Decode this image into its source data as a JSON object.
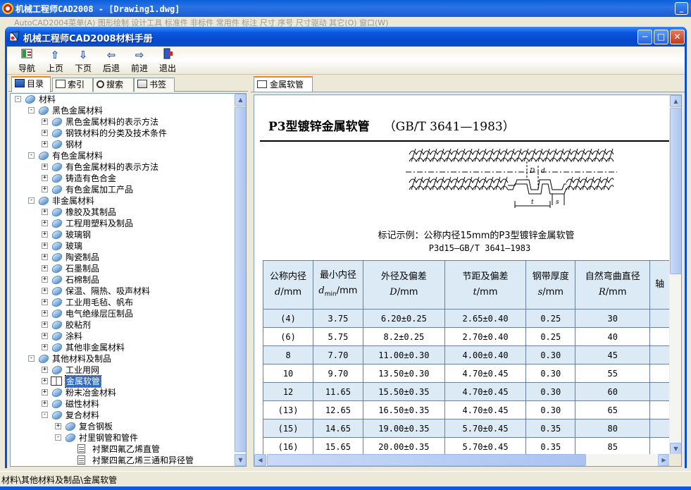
{
  "cad_window": {
    "title": "机械工程师CAD2008 - [Drawing1.dwg]",
    "menu_text": "AutoCAD2004菜单(A)  图形绘制  设计工具  标准件  非标件  常用件  标注  尺寸  序号  尺寸驱动  其它(O)  窗口(W)"
  },
  "dialog": {
    "title": "机械工程师CAD2008材料手册",
    "minimize_glyph": "─",
    "maximize_glyph": "□",
    "close_glyph": "✕"
  },
  "toolbar": {
    "items": [
      {
        "label": "导航",
        "icon": "nav-icon"
      },
      {
        "label": "上页",
        "icon": "arrow-up-icon"
      },
      {
        "label": "下页",
        "icon": "arrow-down-icon"
      },
      {
        "label": "后退",
        "icon": "arrow-left-icon"
      },
      {
        "label": "前进",
        "icon": "arrow-right-icon"
      },
      {
        "label": "退出",
        "icon": "exit-icon"
      }
    ]
  },
  "left_tabs": [
    "目录",
    "索引",
    "搜索",
    "书签"
  ],
  "tree": [
    {
      "level": 0,
      "label": "材料",
      "exp": "-",
      "icon": "gem"
    },
    {
      "level": 1,
      "label": "黑色金属材料",
      "exp": "-",
      "icon": "gem"
    },
    {
      "level": 2,
      "label": "黑色金属材料的表示方法",
      "exp": "+",
      "icon": "gem"
    },
    {
      "level": 2,
      "label": "钢铁材料的分类及技术条件",
      "exp": "+",
      "icon": "gem"
    },
    {
      "level": 2,
      "label": "钢材",
      "exp": "+",
      "icon": "gem"
    },
    {
      "level": 1,
      "label": "有色金属材料",
      "exp": "-",
      "icon": "gem"
    },
    {
      "level": 2,
      "label": "有色金属材料的表示方法",
      "exp": "+",
      "icon": "gem"
    },
    {
      "level": 2,
      "label": "铸造有色合金",
      "exp": "+",
      "icon": "gem"
    },
    {
      "level": 2,
      "label": "有色金属加工产品",
      "exp": "+",
      "icon": "gem"
    },
    {
      "level": 1,
      "label": "非金属材料",
      "exp": "-",
      "icon": "gem"
    },
    {
      "level": 2,
      "label": "橡胶及其制品",
      "exp": "+",
      "icon": "gem"
    },
    {
      "level": 2,
      "label": "工程用塑料及制品",
      "exp": "+",
      "icon": "gem"
    },
    {
      "level": 2,
      "label": "玻璃钢",
      "exp": "+",
      "icon": "gem"
    },
    {
      "level": 2,
      "label": "玻璃",
      "exp": "+",
      "icon": "gem"
    },
    {
      "level": 2,
      "label": "陶瓷制品",
      "exp": "+",
      "icon": "gem"
    },
    {
      "level": 2,
      "label": "石墨制品",
      "exp": "+",
      "icon": "gem"
    },
    {
      "level": 2,
      "label": "石棉制品",
      "exp": "+",
      "icon": "gem"
    },
    {
      "level": 2,
      "label": "保温、隔热、吸声材料",
      "exp": "+",
      "icon": "gem"
    },
    {
      "level": 2,
      "label": "工业用毛毡、帆布",
      "exp": "+",
      "icon": "gem"
    },
    {
      "level": 2,
      "label": "电气绝缘层压制品",
      "exp": "+",
      "icon": "gem"
    },
    {
      "level": 2,
      "label": "胶粘剂",
      "exp": "+",
      "icon": "gem"
    },
    {
      "level": 2,
      "label": "涂料",
      "exp": "+",
      "icon": "gem"
    },
    {
      "level": 2,
      "label": "其他非金属材料",
      "exp": "+",
      "icon": "gem"
    },
    {
      "level": 1,
      "label": "其他材料及制品",
      "exp": "-",
      "icon": "gem"
    },
    {
      "level": 2,
      "label": "工业用网",
      "exp": "+",
      "icon": "gem"
    },
    {
      "level": 2,
      "label": "金属软管",
      "exp": "+",
      "icon": "book",
      "selected": true
    },
    {
      "level": 2,
      "label": "粉末冶金材料",
      "exp": "+",
      "icon": "gem"
    },
    {
      "level": 2,
      "label": "磁性材料",
      "exp": "+",
      "icon": "gem"
    },
    {
      "level": 2,
      "label": "复合材料",
      "exp": "-",
      "icon": "gem"
    },
    {
      "level": 3,
      "label": "复合钢板",
      "exp": "+",
      "icon": "gem"
    },
    {
      "level": 3,
      "label": "衬里钢管和管件",
      "exp": "-",
      "icon": "gem"
    },
    {
      "level": 4,
      "label": "衬聚四氟乙烯直管",
      "exp": "",
      "icon": "doc"
    },
    {
      "level": 4,
      "label": "衬聚四氟乙烯三通和异径管",
      "exp": "",
      "icon": "doc"
    }
  ],
  "right_tab": "金属软管",
  "document": {
    "title": "P3型镀锌金属软管",
    "standard": "（GB/T 3641—1983）",
    "figure_labels": {
      "D": "D",
      "d": "d",
      "t": "t",
      "s": "s"
    },
    "caption_line1": "标记示例：公称内径15mm的P3型镀锌金属软管",
    "caption_line2": "P3d15—GB/T  3641—1983",
    "columns": [
      {
        "line1": "公称内径",
        "line2": "d/mm"
      },
      {
        "line1": "最小内径",
        "line2": "dmin/mm"
      },
      {
        "line1": "外径及偏差",
        "line2": "D/mm"
      },
      {
        "line1": "节距及偏差",
        "line2": "t/mm"
      },
      {
        "line1": "钢带厚度",
        "line2": "s/mm"
      },
      {
        "line1": "自然弯曲直径",
        "line2": "R/mm"
      },
      {
        "line1": "轴",
        "line2": ""
      }
    ],
    "rows": [
      [
        "(4)",
        "3.75",
        "6.20±0.25",
        "2.65±0.40",
        "0.25",
        "30"
      ],
      [
        "(6)",
        "5.75",
        "8.2±0.25",
        "2.70±0.40",
        "0.25",
        "40"
      ],
      [
        "8",
        "7.70",
        "11.00±0.30",
        "4.00±0.40",
        "0.30",
        "45"
      ],
      [
        "10",
        "9.70",
        "13.50±0.30",
        "4.70±0.45",
        "0.30",
        "55"
      ],
      [
        "12",
        "11.65",
        "15.50±0.35",
        "4.70±0.45",
        "0.30",
        "60"
      ],
      [
        "(13)",
        "12.65",
        "16.50±0.35",
        "4.70±0.45",
        "0.30",
        "65"
      ],
      [
        "(15)",
        "14.65",
        "19.00±0.35",
        "5.70±0.45",
        "0.35",
        "80"
      ],
      [
        "(16)",
        "15.65",
        "20.00±0.35",
        "5.70±0.45",
        "0.35",
        "85"
      ]
    ]
  },
  "status": "材料\\其他材料及制品\\金属软管",
  "colors": {
    "selection": "#316AC5",
    "table_header": "#DCEAF6",
    "title_bar": "#0A58E0"
  }
}
